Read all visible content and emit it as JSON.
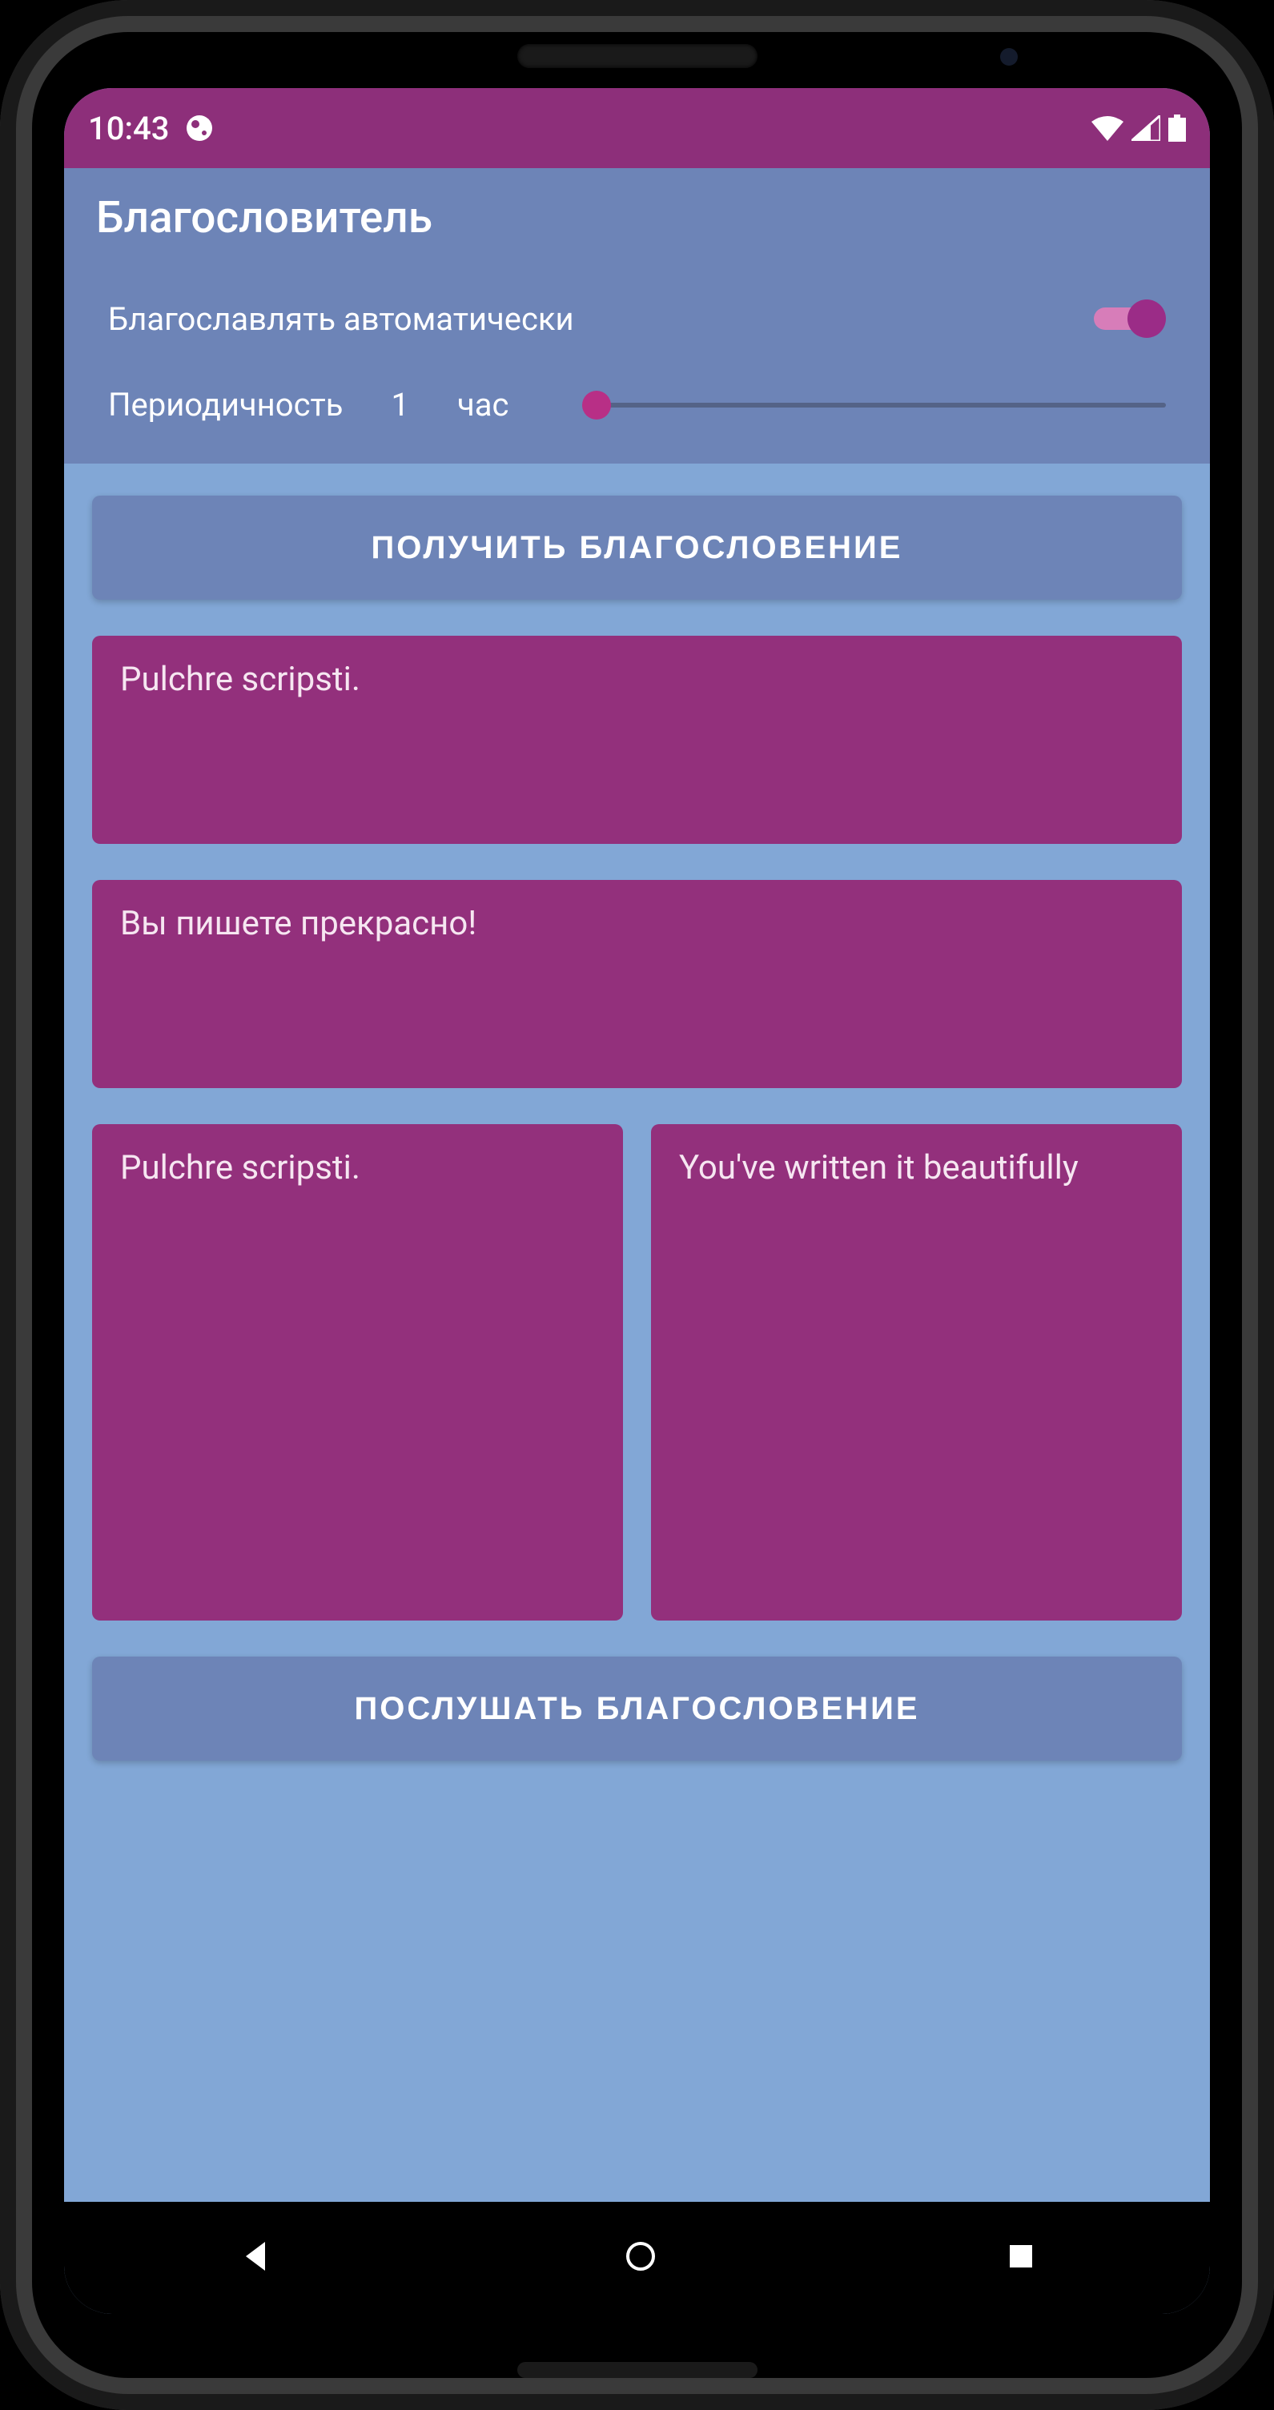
{
  "statusbar": {
    "time": "10:43"
  },
  "app": {
    "title": "Благословитель"
  },
  "settings": {
    "auto_label": "Благославлять автоматически",
    "auto_on": true,
    "periodicity_label": "Периодичность",
    "periodicity_value": "1",
    "periodicity_unit": "час"
  },
  "buttons": {
    "get_blessing": "ПОЛУЧИТЬ БЛАГОСЛОВЕНИЕ",
    "listen_blessing": "ПОСЛУШАТЬ БЛАГОСЛОВЕНИЕ"
  },
  "cards": {
    "card1": "Pulchre scripsti.",
    "card2": "Вы пишете прекрасно!",
    "card3": "Pulchre scripsti.",
    "card4": "You've written it beautifully"
  }
}
